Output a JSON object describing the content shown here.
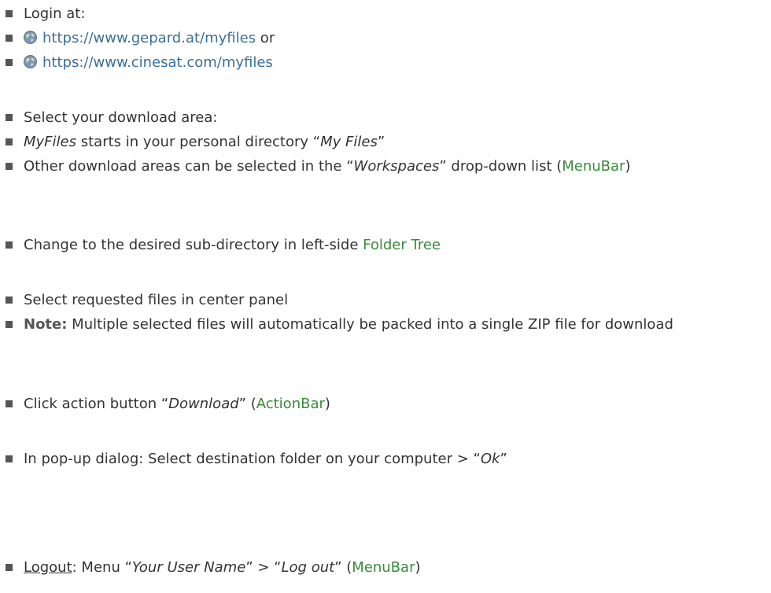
{
  "section_login": {
    "label": "Login at:",
    "url1": "https://www.gepard.at/myfiles",
    "or_word": " or",
    "url2": "https://www.cinesat.com/myfiles"
  },
  "section_area": {
    "label": "Select your download area:",
    "myfiles_em": "MyFiles",
    "myfiles_rest": " starts in your personal directory “",
    "myfiles_dir": "My Files",
    "myfiles_close": "”",
    "other_pre": "Other download areas can be selected in the “",
    "other_em": "Workspaces",
    "other_mid": "” drop-down list (",
    "other_link": "MenuBar",
    "other_close": ")"
  },
  "section_folder": {
    "pre": "Change to the desired sub-directory in left-side ",
    "link": "Folder Tree"
  },
  "section_files": {
    "select": "Select requested files in center panel",
    "note_label": "Note:",
    "note_text": " Multiple selected files will automatically be packed into a single ZIP file for download"
  },
  "section_download": {
    "pre": "Click action button “",
    "em": "Download",
    "mid": "” (",
    "link": "ActionBar",
    "close": ")"
  },
  "section_dialog": {
    "pre": "In pop-up dialog: Select destination folder on your computer > “",
    "em": "Ok",
    "close": "”"
  },
  "section_logout": {
    "label": "Logout",
    "pre": ": Menu “",
    "em1": "Your User Name",
    "mid": "” > “",
    "em2": "Log out",
    "mid2": "” (",
    "link": "MenuBar",
    "close": ")"
  },
  "colors": {
    "text": "#333333",
    "link_green": "#3a8a3a",
    "link_blue": "#3a6f9a",
    "bullet": "#555555"
  },
  "icons": [
    "globe-icon"
  ]
}
